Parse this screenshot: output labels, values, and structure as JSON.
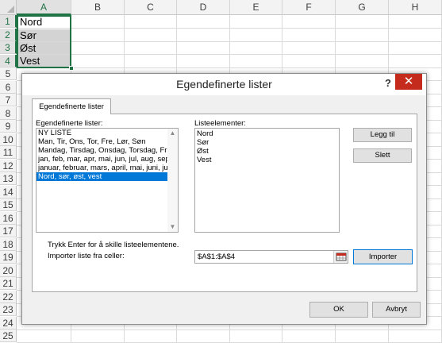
{
  "spreadsheet": {
    "columns": [
      "A",
      "B",
      "C",
      "D",
      "E",
      "F",
      "G",
      "H"
    ],
    "rows": [
      "1",
      "2",
      "3",
      "4",
      "5",
      "6",
      "7",
      "8",
      "9",
      "10",
      "11",
      "12",
      "13",
      "14",
      "15",
      "16",
      "17",
      "18",
      "19",
      "20",
      "21",
      "22",
      "23",
      "24",
      "25"
    ],
    "cells": {
      "A1": "Nord",
      "A2": "Sør",
      "A3": "Øst",
      "A4": "Vest"
    }
  },
  "dialog": {
    "title": "Egendefinerte lister",
    "help_label": "?",
    "close_label": "✕",
    "tab_label": "Egendefinerte lister",
    "custom_lists_label": "Egendefinerte lister:",
    "custom_lists": [
      "NY LISTE",
      "Man, Tir, Ons, Tor, Fre, Lør, Søn",
      "Mandag, Tirsdag, Onsdag, Torsdag, Fred",
      "jan, feb, mar, apr, mai, jun, jul, aug, sep,",
      "januar, februar, mars, april, mai, juni, juli,",
      "Nord, sør, øst, vest"
    ],
    "selected_list_index": 5,
    "list_entries_label": "Listeelementer:",
    "list_entries": [
      "Nord",
      "Sør",
      "Øst",
      "Vest"
    ],
    "add_button": "Legg til",
    "delete_button": "Slett",
    "hint_text": "Trykk Enter for å skille listeelementene.",
    "import_label": "Importer liste fra celler:",
    "import_range": "$A$1:$A$4",
    "import_button": "Importer",
    "ok_button": "OK",
    "cancel_button": "Avbryt"
  }
}
